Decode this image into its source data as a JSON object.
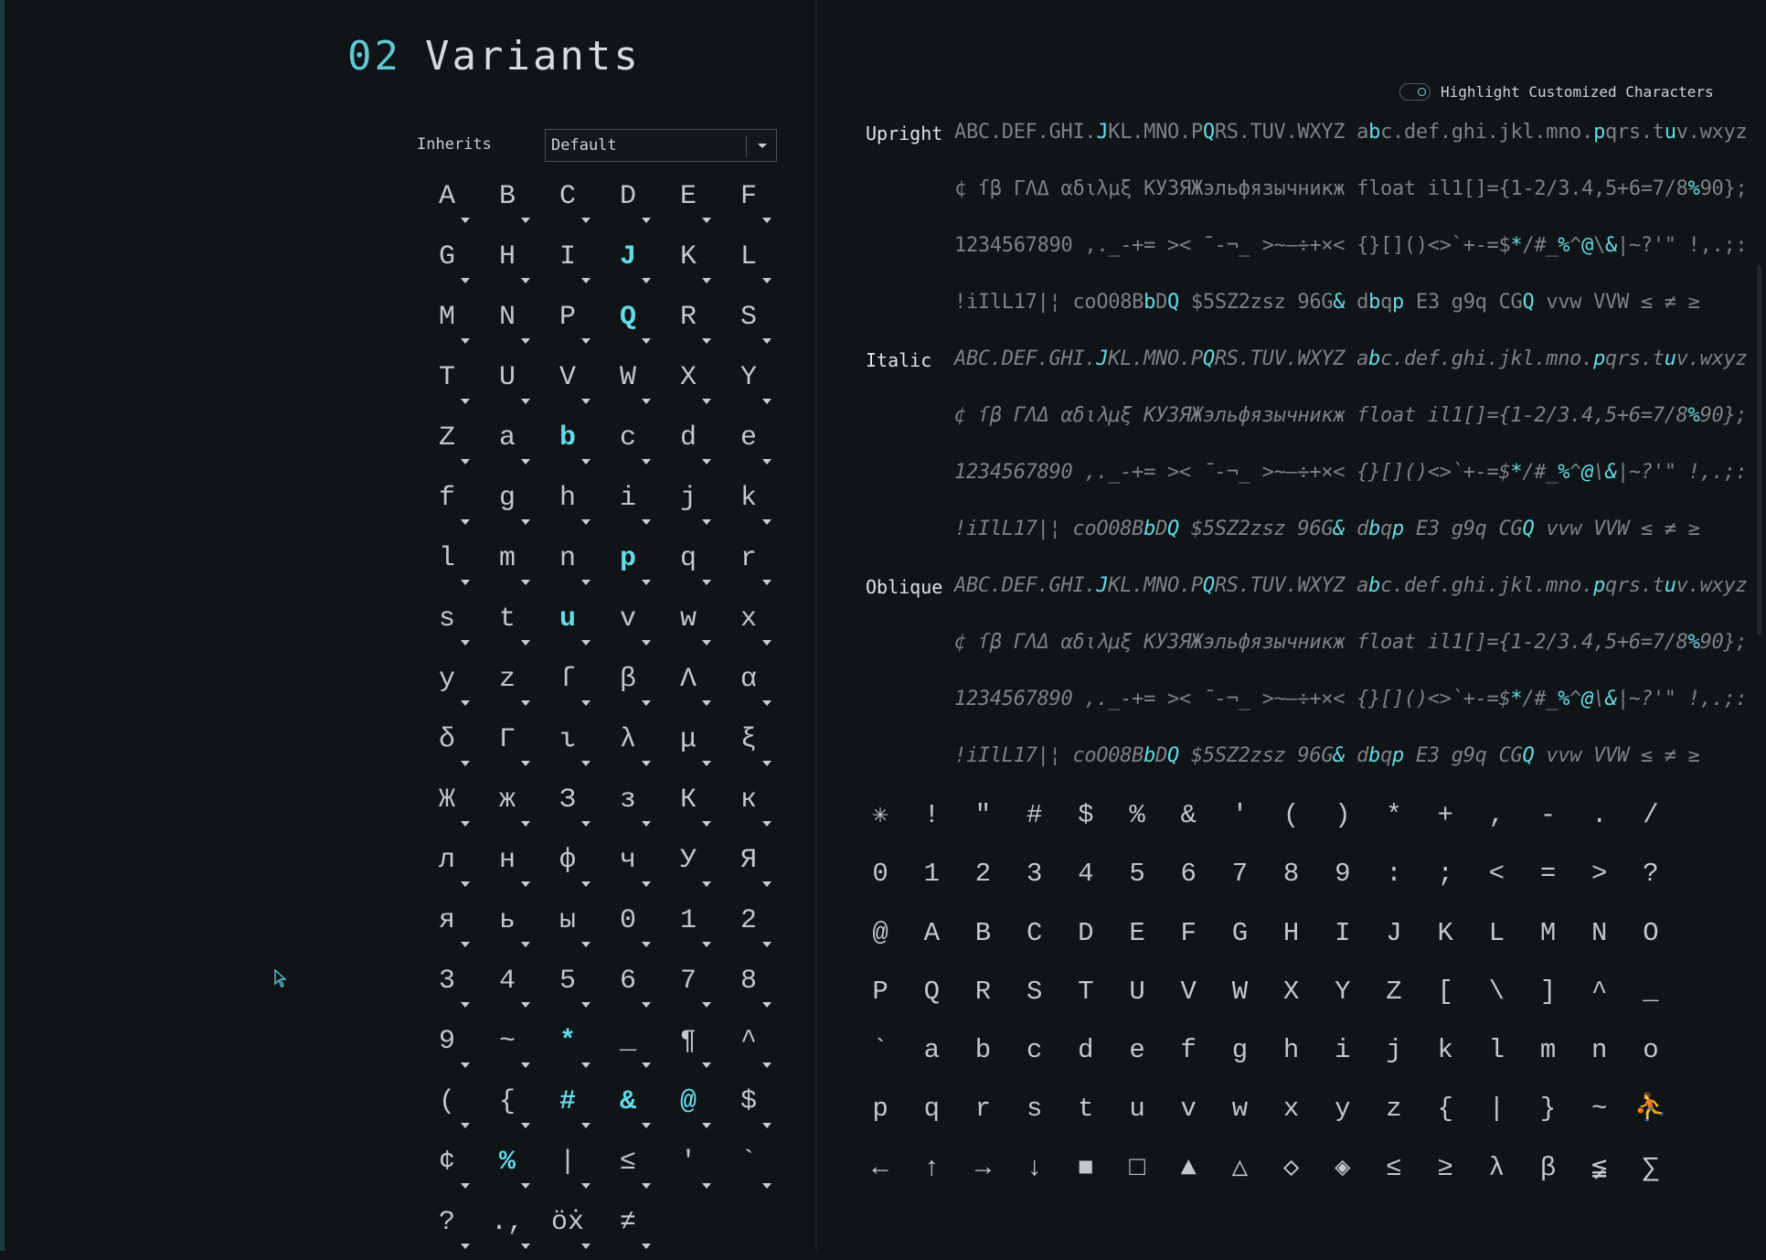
{
  "section": {
    "number": "02",
    "title": "Variants"
  },
  "inherits": {
    "label": "Inherits",
    "value": "Default"
  },
  "glyphs": [
    {
      "ch": "A"
    },
    {
      "ch": "B"
    },
    {
      "ch": "C"
    },
    {
      "ch": "D"
    },
    {
      "ch": "E"
    },
    {
      "ch": "F"
    },
    {
      "ch": "G"
    },
    {
      "ch": "H"
    },
    {
      "ch": "I"
    },
    {
      "ch": "J",
      "hl": true
    },
    {
      "ch": "K"
    },
    {
      "ch": "L"
    },
    {
      "ch": "M"
    },
    {
      "ch": "N"
    },
    {
      "ch": "P"
    },
    {
      "ch": "Q",
      "hl": true
    },
    {
      "ch": "R"
    },
    {
      "ch": "S"
    },
    {
      "ch": "T"
    },
    {
      "ch": "U"
    },
    {
      "ch": "V"
    },
    {
      "ch": "W"
    },
    {
      "ch": "X"
    },
    {
      "ch": "Y"
    },
    {
      "ch": "Z"
    },
    {
      "ch": "a"
    },
    {
      "ch": "b",
      "hl": true
    },
    {
      "ch": "c"
    },
    {
      "ch": "d"
    },
    {
      "ch": "e"
    },
    {
      "ch": "f"
    },
    {
      "ch": "g"
    },
    {
      "ch": "h"
    },
    {
      "ch": "i"
    },
    {
      "ch": "j"
    },
    {
      "ch": "k"
    },
    {
      "ch": "l"
    },
    {
      "ch": "m"
    },
    {
      "ch": "n"
    },
    {
      "ch": "p",
      "hl": true
    },
    {
      "ch": "q"
    },
    {
      "ch": "r"
    },
    {
      "ch": "s"
    },
    {
      "ch": "t"
    },
    {
      "ch": "u",
      "hl": true
    },
    {
      "ch": "v"
    },
    {
      "ch": "w"
    },
    {
      "ch": "x"
    },
    {
      "ch": "y"
    },
    {
      "ch": "z"
    },
    {
      "ch": "ſ"
    },
    {
      "ch": "β"
    },
    {
      "ch": "Λ"
    },
    {
      "ch": "α"
    },
    {
      "ch": "δ"
    },
    {
      "ch": "Γ"
    },
    {
      "ch": "ι"
    },
    {
      "ch": "λ"
    },
    {
      "ch": "μ"
    },
    {
      "ch": "ξ"
    },
    {
      "ch": "Ж"
    },
    {
      "ch": "ж"
    },
    {
      "ch": "З"
    },
    {
      "ch": "з"
    },
    {
      "ch": "К"
    },
    {
      "ch": "к"
    },
    {
      "ch": "л"
    },
    {
      "ch": "н"
    },
    {
      "ch": "ф"
    },
    {
      "ch": "ч"
    },
    {
      "ch": "У"
    },
    {
      "ch": "Я"
    },
    {
      "ch": "я"
    },
    {
      "ch": "ь"
    },
    {
      "ch": "ы"
    },
    {
      "ch": "0"
    },
    {
      "ch": "1"
    },
    {
      "ch": "2"
    },
    {
      "ch": "3"
    },
    {
      "ch": "4"
    },
    {
      "ch": "5"
    },
    {
      "ch": "6"
    },
    {
      "ch": "7"
    },
    {
      "ch": "8"
    },
    {
      "ch": "9"
    },
    {
      "ch": "~"
    },
    {
      "ch": "*",
      "hl": true
    },
    {
      "ch": "_"
    },
    {
      "ch": "¶"
    },
    {
      "ch": "^"
    },
    {
      "ch": "("
    },
    {
      "ch": "{"
    },
    {
      "ch": "#",
      "hl": true
    },
    {
      "ch": "&",
      "hl": true
    },
    {
      "ch": "@",
      "hl": true
    },
    {
      "ch": "$"
    },
    {
      "ch": "¢"
    },
    {
      "ch": "%",
      "hl": true
    },
    {
      "ch": "|"
    },
    {
      "ch": "≤"
    },
    {
      "ch": "'"
    },
    {
      "ch": "`"
    },
    {
      "ch": "?"
    },
    {
      "ch": ".,"
    },
    {
      "ch": "öẋ"
    },
    {
      "ch": "≠"
    }
  ],
  "highlight_toggle": {
    "label": "Highlight Customized Characters"
  },
  "preview": {
    "styles": [
      "Upright",
      "Italic",
      "Oblique"
    ],
    "lines": [
      [
        {
          "t": "ABC.DEF.GHI."
        },
        {
          "t": "J",
          "c": 1
        },
        {
          "t": "KL.MNO.P"
        },
        {
          "t": "Q",
          "c": 1
        },
        {
          "t": "RS.TUV.WXYZ a"
        },
        {
          "t": "b",
          "c": 1
        },
        {
          "t": "c.def.ghi.jkl.mno."
        },
        {
          "t": "p",
          "c": 1
        },
        {
          "t": "qrs.t"
        },
        {
          "t": "u",
          "c": 1
        },
        {
          "t": "v.wxyz"
        }
      ],
      [
        {
          "t": "¢ ſβ ΓΛΔ αδιλμξ КУЗЯЖэльфязычникж float il1[]={1-2/3.4,5+6=7/8"
        },
        {
          "t": "%",
          "c": 1
        },
        {
          "t": "90};"
        }
      ],
      [
        {
          "t": "1234567890 ,._-+= >< ¯-¬_ >~–÷+×< {}[]()<>`+-=$"
        },
        {
          "t": "*",
          "c": 1
        },
        {
          "t": "/#_"
        },
        {
          "t": "%",
          "c": 1
        },
        {
          "t": "^"
        },
        {
          "t": "@",
          "c": 1
        },
        {
          "t": "\\"
        },
        {
          "t": "&",
          "c": 1
        },
        {
          "t": "|~?'\" !,.;:"
        }
      ],
      [
        {
          "t": "!iIlL17|¦ coO08B"
        },
        {
          "t": "b",
          "c": 1
        },
        {
          "t": "D"
        },
        {
          "t": "Q",
          "c": 1
        },
        {
          "t": " $5SZ2zsz 96G"
        },
        {
          "t": "&",
          "c": 1
        },
        {
          "t": " d"
        },
        {
          "t": "b",
          "c": 1
        },
        {
          "t": "q"
        },
        {
          "t": "p",
          "c": 1
        },
        {
          "t": " E3 g9q CG"
        },
        {
          "t": "Q",
          "c": 1
        },
        {
          "t": " vvw VVW ≤ ≠ ≥"
        }
      ]
    ]
  },
  "charmap": [
    "✳",
    "!",
    "\"",
    "#",
    "$",
    "%",
    "&",
    "'",
    "(",
    ")",
    "*",
    "+",
    ",",
    "-",
    ".",
    "/",
    "0",
    "1",
    "2",
    "3",
    "4",
    "5",
    "6",
    "7",
    "8",
    "9",
    ":",
    ";",
    "<",
    "=",
    ">",
    "?",
    "@",
    "A",
    "B",
    "C",
    "D",
    "E",
    "F",
    "G",
    "H",
    "I",
    "J",
    "K",
    "L",
    "M",
    "N",
    "O",
    "P",
    "Q",
    "R",
    "S",
    "T",
    "U",
    "V",
    "W",
    "X",
    "Y",
    "Z",
    "[",
    "\\",
    "]",
    "^",
    "_",
    "`",
    "a",
    "b",
    "c",
    "d",
    "e",
    "f",
    "g",
    "h",
    "i",
    "j",
    "k",
    "l",
    "m",
    "n",
    "o",
    "p",
    "q",
    "r",
    "s",
    "t",
    "u",
    "v",
    "w",
    "x",
    "y",
    "z",
    "{",
    "|",
    "}",
    "~",
    "⛹",
    "←",
    "↑",
    "→",
    "↓",
    "■",
    "□",
    "▲",
    "△",
    "◇",
    "◈",
    "≤",
    "≥",
    "λ",
    "β",
    "≨",
    "∑"
  ],
  "colors": {
    "accent": "#64dbe8",
    "background": "#0f1416",
    "text": "#c3c8cb",
    "dim": "#7b8387"
  }
}
